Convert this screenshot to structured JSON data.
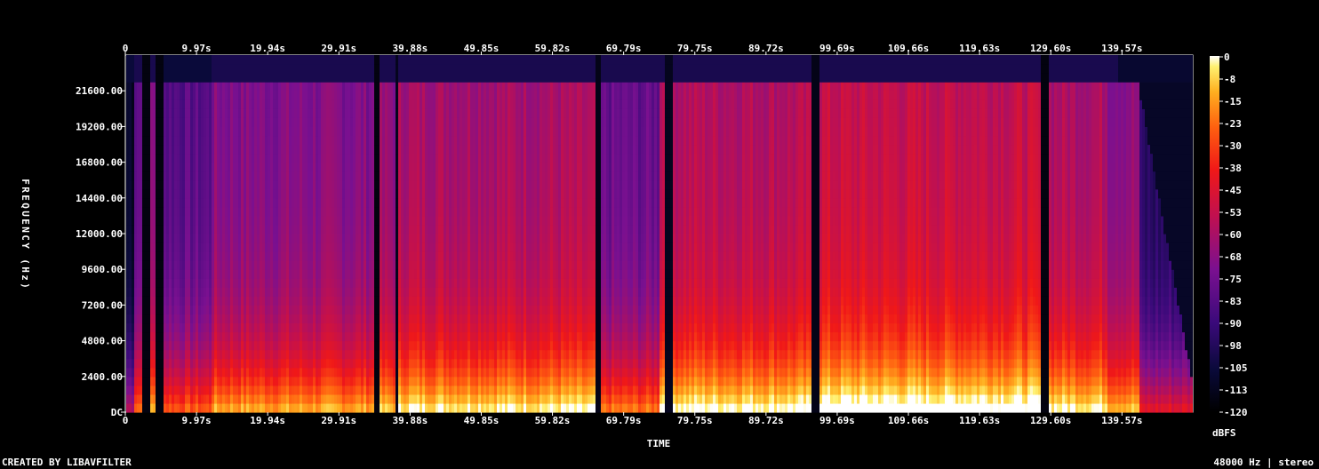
{
  "chart_data": {
    "type": "heatmap",
    "title": "",
    "xlabel": "TIME",
    "ylabel": "FREQUENCY (Hz)",
    "x_ticks": [
      "0",
      "9.97s",
      "19.94s",
      "29.91s",
      "39.88s",
      "49.85s",
      "59.82s",
      "69.79s",
      "79.75s",
      "89.72s",
      "99.69s",
      "109.66s",
      "119.63s",
      "129.60s",
      "139.57s"
    ],
    "y_ticks": [
      "DC",
      "2400.00",
      "4800.00",
      "7200.00",
      "9600.00",
      "12000.00",
      "14400.00",
      "16800.00",
      "19200.00",
      "21600.00"
    ],
    "x_range_s": [
      0,
      149.5
    ],
    "y_range_hz": [
      0,
      24000
    ],
    "colorbar": {
      "label": "dBFS",
      "ticks": [
        "0",
        "-8",
        "-15",
        "-23",
        "-30",
        "-38",
        "-45",
        "-53",
        "-60",
        "-68",
        "-75",
        "-83",
        "-90",
        "-98",
        "-105",
        "-113",
        "-120"
      ],
      "range": [
        -120,
        0
      ]
    },
    "activity_profile": {
      "description_units": "time in seconds, relative intensity 0-1",
      "segments": [
        {
          "start": 0.0,
          "end": 1.0,
          "level": 0.15
        },
        {
          "start": 1.0,
          "end": 2.2,
          "level": 0.55
        },
        {
          "start": 2.2,
          "end": 3.2,
          "level": 0.05
        },
        {
          "start": 3.2,
          "end": 4.2,
          "level": 0.7
        },
        {
          "start": 4.2,
          "end": 5.0,
          "level": 0.05
        },
        {
          "start": 5.0,
          "end": 12.0,
          "level": 0.5
        },
        {
          "start": 12.0,
          "end": 34.5,
          "level": 0.65
        },
        {
          "start": 34.5,
          "end": 35.6,
          "level": 0.05
        },
        {
          "start": 35.6,
          "end": 37.6,
          "level": 0.7
        },
        {
          "start": 37.6,
          "end": 38.0,
          "level": 0.1
        },
        {
          "start": 38.0,
          "end": 65.5,
          "level": 0.78
        },
        {
          "start": 65.5,
          "end": 66.5,
          "level": 0.08
        },
        {
          "start": 66.5,
          "end": 74.5,
          "level": 0.55
        },
        {
          "start": 74.5,
          "end": 75.5,
          "level": 0.85
        },
        {
          "start": 75.5,
          "end": 76.5,
          "level": 0.1
        },
        {
          "start": 76.5,
          "end": 96.0,
          "level": 0.82
        },
        {
          "start": 96.0,
          "end": 97.0,
          "level": 0.08
        },
        {
          "start": 97.0,
          "end": 128.2,
          "level": 0.88
        },
        {
          "start": 128.2,
          "end": 129.3,
          "level": 0.05
        },
        {
          "start": 129.3,
          "end": 137.5,
          "level": 0.8
        },
        {
          "start": 137.5,
          "end": 142.0,
          "level": 0.7
        },
        {
          "start": 142.0,
          "end": 149.5,
          "level": 0.3
        }
      ]
    }
  },
  "footer": {
    "left": "CREATED BY LIBAVFILTER",
    "right": "48000 Hz | stereo"
  }
}
